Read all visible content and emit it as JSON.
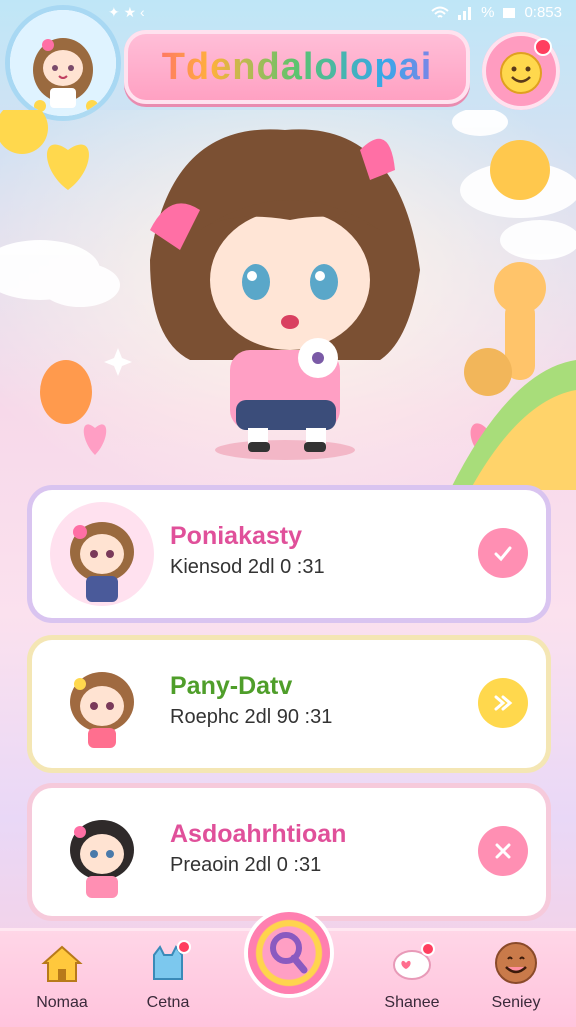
{
  "status_bar": {
    "time": "0:853",
    "battery_label": "%"
  },
  "header": {
    "title": "Tdendalolopai"
  },
  "cards": [
    {
      "name": "Poniakasty",
      "time": "Kiensod 2dl 0 :31",
      "name_color": "#e0509a",
      "action_icon": "check-icon",
      "action_color": "#ff8fb3"
    },
    {
      "name": "Pany-Datv",
      "time": "Roephc 2dl 90 :31",
      "name_color": "#4f9e2a",
      "action_icon": "double-arrow-icon",
      "action_color": "#ffd84d"
    },
    {
      "name": "Asdoahrhtioan",
      "time": "Preaoin 2dl 0 :31",
      "name_color": "#e0509a",
      "action_icon": "close-icon",
      "action_color": "#ff8fb3"
    }
  ],
  "bottom_nav": [
    {
      "label": "Nomaa",
      "icon": "home-icon"
    },
    {
      "label": "Cetna",
      "icon": "cat-icon"
    },
    {
      "label": "",
      "icon": "search-icon"
    },
    {
      "label": "Shanee",
      "icon": "chat-icon"
    },
    {
      "label": "Seniey",
      "icon": "smiley-icon"
    }
  ]
}
